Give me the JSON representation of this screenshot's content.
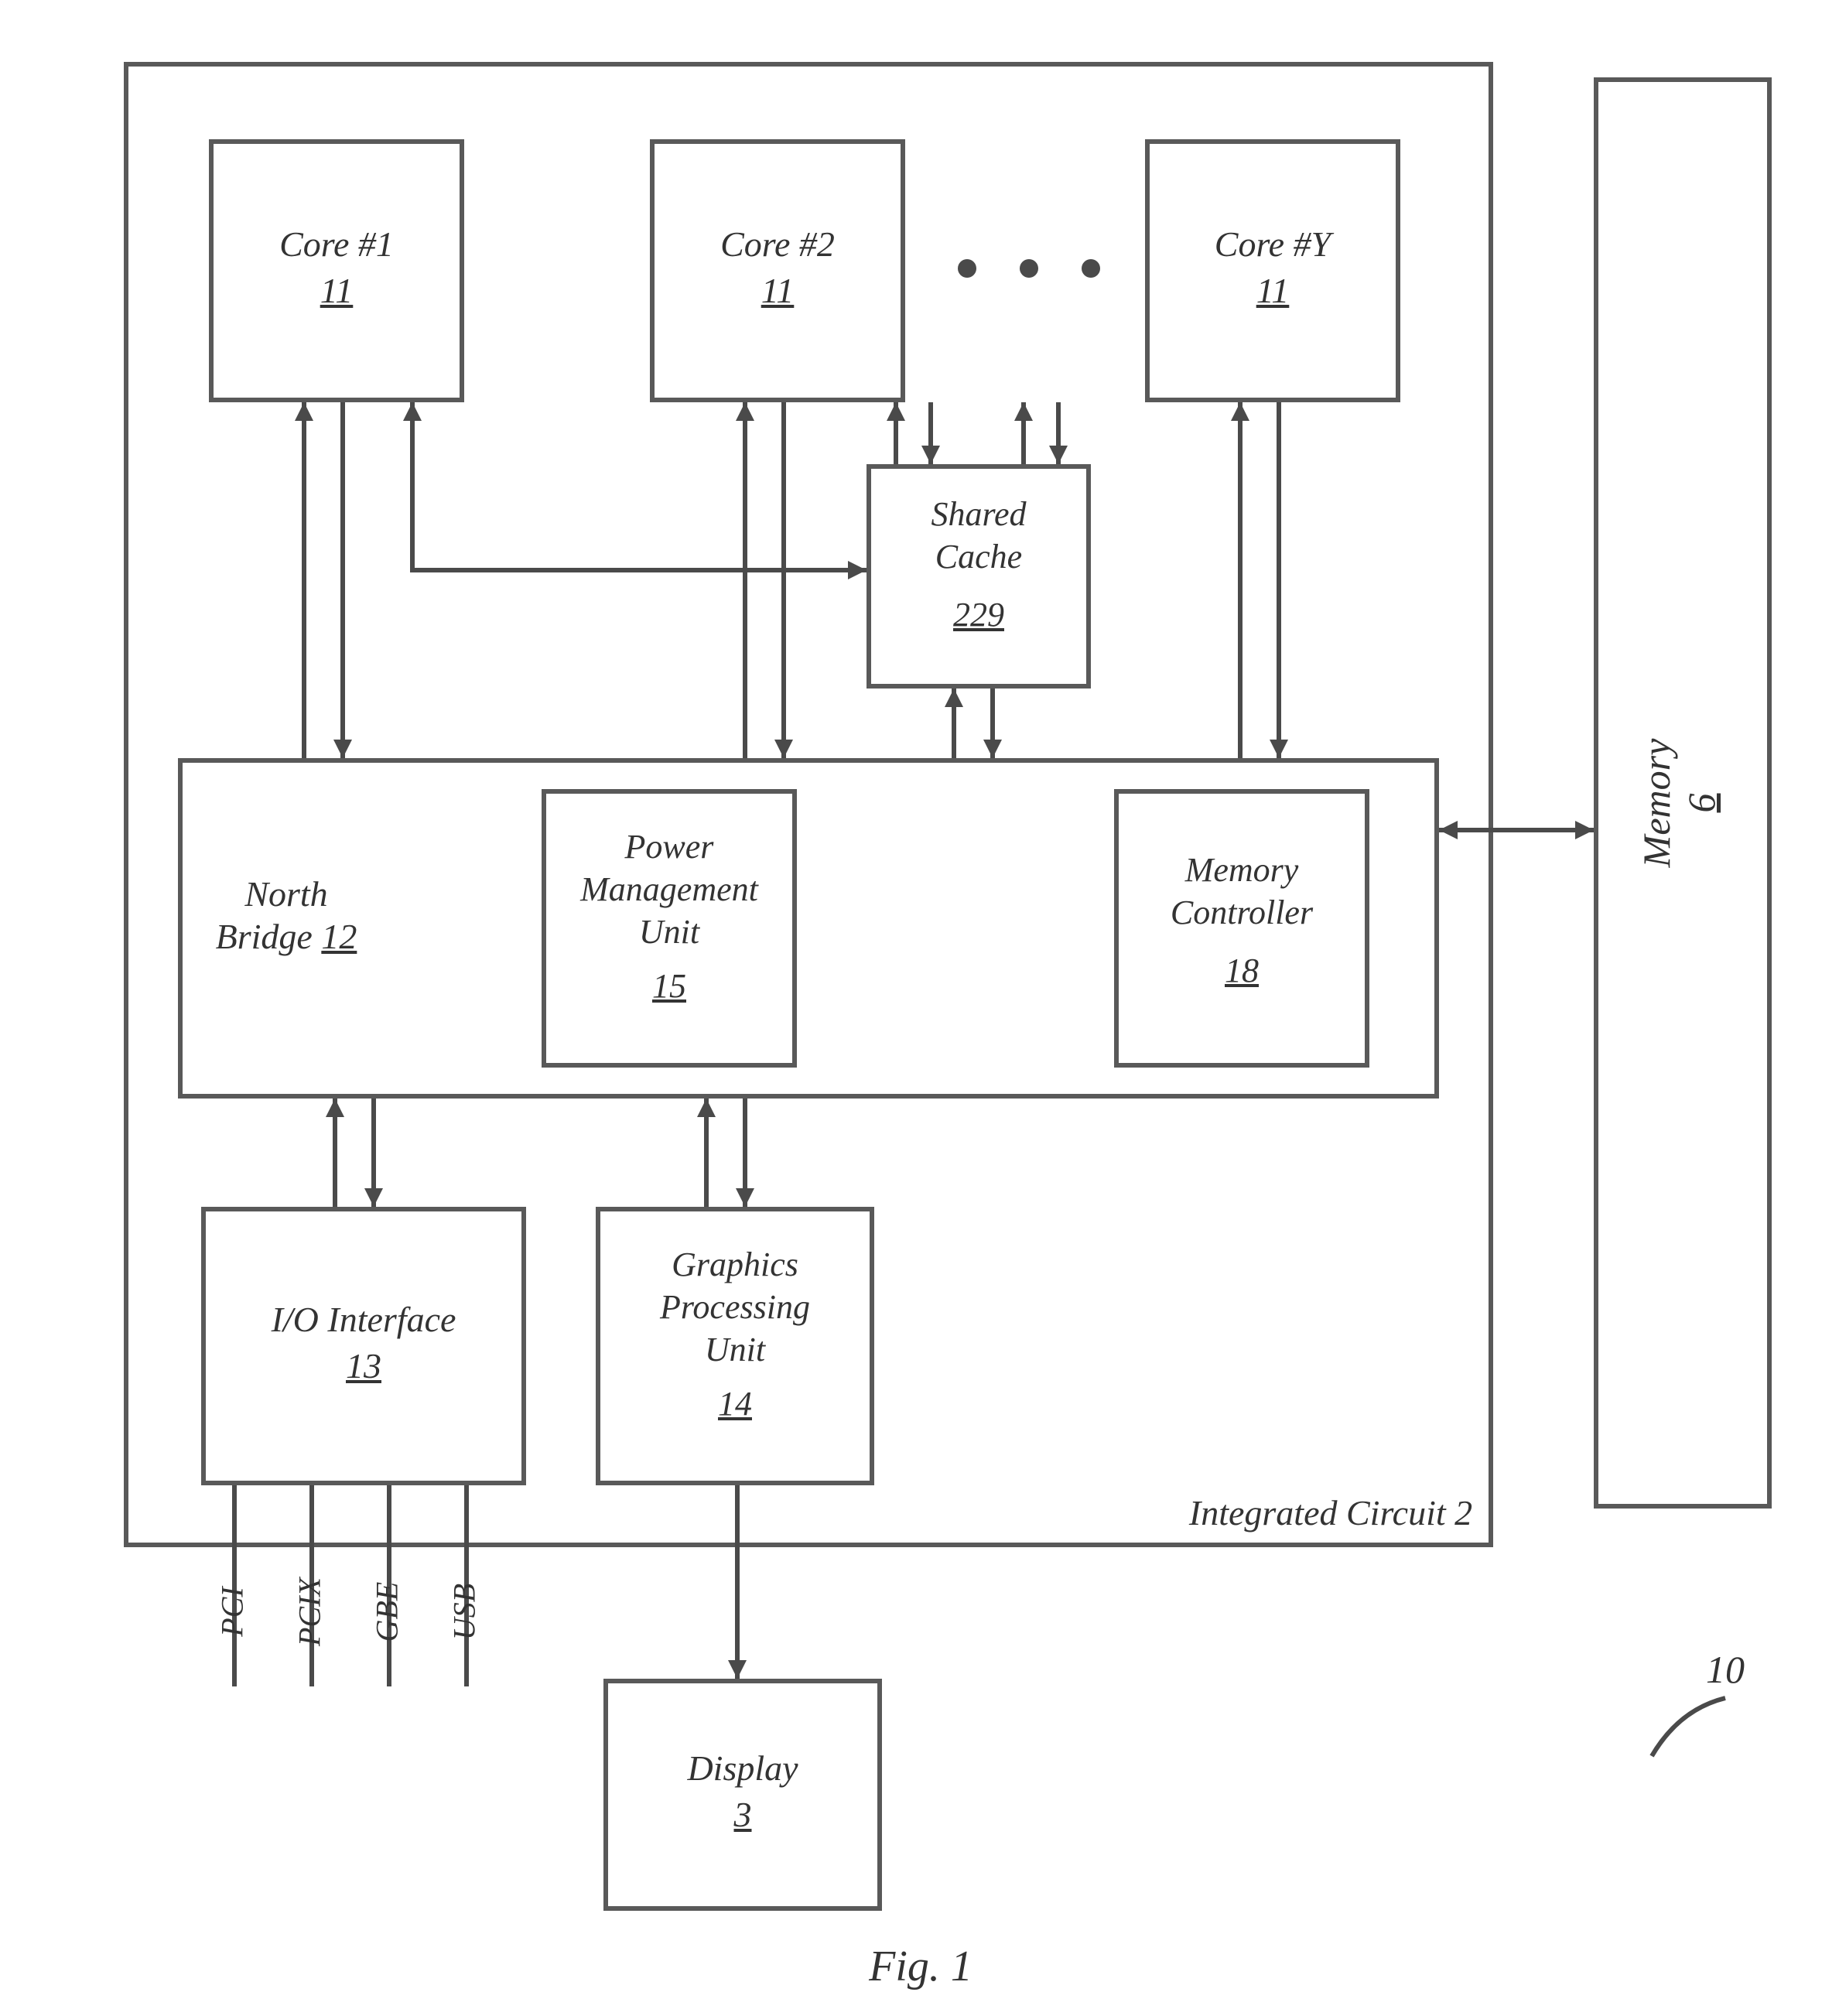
{
  "figure_label": "Fig. 1",
  "ref_right": "10",
  "ic": {
    "label": "Integrated Circuit 2"
  },
  "cores": {
    "c1": {
      "label": "Core #1",
      "num": "11"
    },
    "c2": {
      "label": "Core #2",
      "num": "11"
    },
    "cy": {
      "label": "Core #Y",
      "num": "11"
    }
  },
  "cache": {
    "label_a": "Shared",
    "label_b": "Cache",
    "num": "229"
  },
  "north_bridge": {
    "label": "North",
    "label2": "Bridge",
    "num": "12"
  },
  "pmu": {
    "label_a": "Power",
    "label_b": "Management",
    "label_c": "Unit",
    "num": "15"
  },
  "memctl": {
    "label_a": "Memory",
    "label_b": "Controller",
    "num": "18"
  },
  "io": {
    "label": "I/O Interface",
    "num": "13"
  },
  "gpu": {
    "label_a": "Graphics",
    "label_b": "Processing",
    "label_c": "Unit",
    "num": "14"
  },
  "display": {
    "label": "Display",
    "num": "3"
  },
  "memory": {
    "label": "Memory",
    "num": "6"
  },
  "buses": {
    "pci": "PCI",
    "pcix": "PCIX",
    "gbe": "GBE",
    "usb": "USB"
  }
}
